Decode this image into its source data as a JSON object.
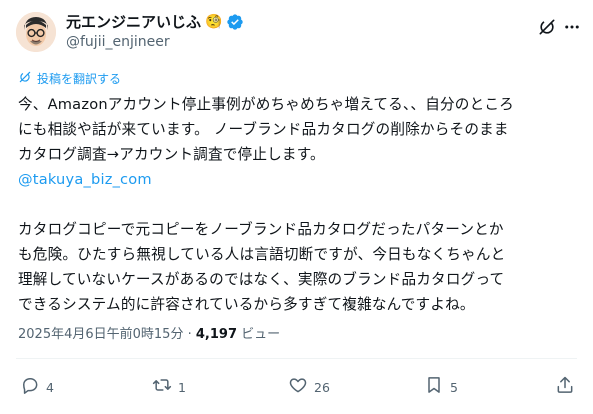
{
  "author": {
    "display_name": "元エンジニアいじふ",
    "name_emoji": "🧐",
    "handle": "@fujii_enjineer",
    "verified": true
  },
  "header": {
    "grok_icon": "grok-slash-icon",
    "more_icon": "more-dots-icon"
  },
  "translate_label": "投稿を翻訳する",
  "post": {
    "paragraph1": "今、Amazonアカウント停止事例がめちゃめちゃ増えてる、、自分のところ\nにも相談や話が来ています。 ノーブランド品カタログの削除からそのまま\nカタログ調査→アカウント調査で停止します。",
    "mention": "@takuya_biz_com",
    "paragraph2": "カタログコピーで元コピーをノーブランド品カタログだったパターンとか\nも危険。ひたすら無視している人は言語切断ですが、今日もなくちゃんと\n理解していないケースがあるのではなく、実際のブランド品カタログって\nできるシステム的に許容されているから多すぎて複雑なんですよね。"
  },
  "meta": {
    "timestamp": "2025年4月6日午前0時15分",
    "separator": "·",
    "views_count": "4,197",
    "views_label": "ビュー"
  },
  "actions": {
    "reply_count": "4",
    "repost_count": "1",
    "like_count": "26",
    "bookmark_count": "5"
  },
  "colors": {
    "link": "#1d9bf0",
    "secondary_text": "#536471",
    "primary_text": "#0f1419"
  }
}
